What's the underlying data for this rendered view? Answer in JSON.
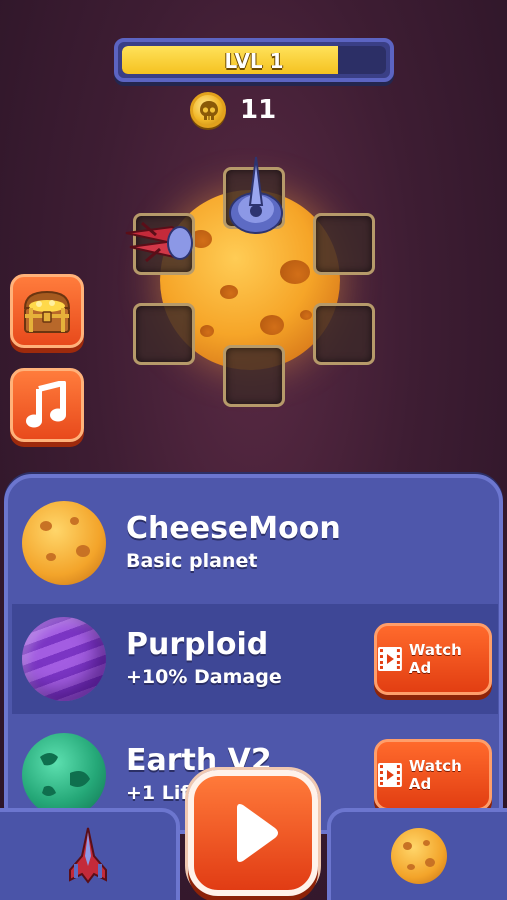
{
  "level": {
    "label": "LVL 1",
    "progress": 0.82
  },
  "currency": {
    "icon": "skull-coin-icon",
    "count": "11"
  },
  "side_buttons": [
    {
      "name": "treasure-chest-button",
      "icon": "treasure-chest-icon"
    },
    {
      "name": "music-button",
      "icon": "music-note-icon"
    }
  ],
  "planets": [
    {
      "name": "CheeseMoon",
      "desc": "Basic planet",
      "action": ""
    },
    {
      "name": "Purploid",
      "desc": "+10% Damage",
      "action": "Watch Ad"
    },
    {
      "name": "Earth V2",
      "desc": "+1 Life",
      "action": "Watch Ad"
    }
  ],
  "bottom_nav": {
    "left_icon": "spaceship-icon",
    "center_icon": "play-icon",
    "right_icon": "planet-icon"
  },
  "colors": {
    "accent_orange": "#e84a1c",
    "panel_blue": "#4e57ab",
    "level_fill": "#f5c221"
  }
}
